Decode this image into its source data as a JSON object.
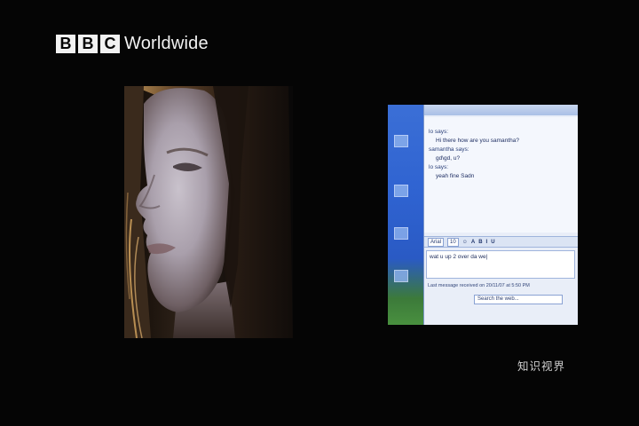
{
  "logo": {
    "letters": [
      "B",
      "B",
      "C"
    ],
    "word": "Worldwide"
  },
  "chat": {
    "history": [
      {
        "kind": "header",
        "text": "lo says:"
      },
      {
        "kind": "msg",
        "text": "Hi there how are you samantha?"
      },
      {
        "kind": "header",
        "text": "samantha says:"
      },
      {
        "kind": "msg",
        "text": "gd\\gd, u?"
      },
      {
        "kind": "header",
        "text": "lo says:"
      },
      {
        "kind": "msg",
        "text": "yeah fine Sadn"
      }
    ],
    "toolbar": {
      "font": "Arial",
      "size": "10"
    },
    "input_text": "wat u up 2 over da we|",
    "status": "Last message received on 20/11/07 at 5:50 PM",
    "search_placeholder": "Search the web..."
  },
  "watermark": "知识视界",
  "colors": {
    "background": "#050505",
    "logo": "#f2f2f2",
    "taskpane": "#2f63d1",
    "chat_bg": "#f4f7fd"
  }
}
